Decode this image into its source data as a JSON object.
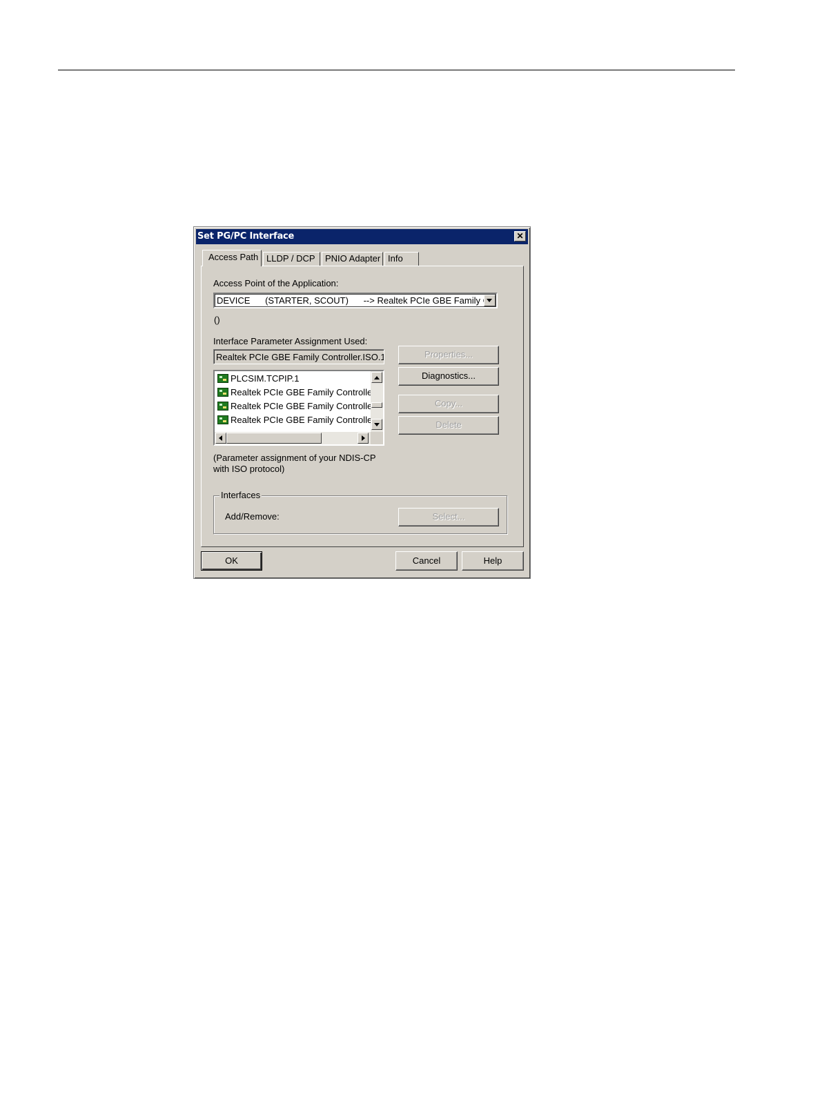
{
  "dialog": {
    "title": "Set PG/PC Interface",
    "close_glyph": "✕",
    "tabs": [
      {
        "label": "Access Path",
        "active": true
      },
      {
        "label": "LLDP / DCP",
        "active": false
      },
      {
        "label": "PNIO Adapter",
        "active": false
      },
      {
        "label": "Info",
        "active": false
      }
    ],
    "access_point": {
      "label": "Access Point of the Application:",
      "value": "DEVICE      (STARTER, SCOUT)      --> Realtek PCIe GBE Family Co",
      "note": "()"
    },
    "interface_param": {
      "label": "Interface Parameter Assignment Used:",
      "value": "Realtek PCIe GBE Family Controller.ISO.1",
      "list_items": [
        {
          "label": "PLCSIM.TCPIP.1",
          "icon": "network-card-icon"
        },
        {
          "label": "Realtek PCIe GBE Family Controller.",
          "icon": "network-card-icon"
        },
        {
          "label": "Realtek PCIe GBE Family Controller.",
          "icon": "network-card-icon"
        },
        {
          "label": "Realtek PCIe GBE Family Controller.",
          "icon": "network-card-icon"
        }
      ],
      "description_line1": "(Parameter assignment of your NDIS-CP",
      "description_line2": "with ISO protocol)"
    },
    "buttons": {
      "properties": "Properties...",
      "diagnostics": "Diagnostics...",
      "copy": "Copy...",
      "delete": "Delete",
      "select": "Select...",
      "ok": "OK",
      "cancel": "Cancel",
      "help": "Help"
    },
    "interfaces_group": {
      "legend": "Interfaces",
      "add_remove_label": "Add/Remove:"
    },
    "colors": {
      "titlebar": "#0a246a",
      "face": "#d4d0c8"
    }
  }
}
